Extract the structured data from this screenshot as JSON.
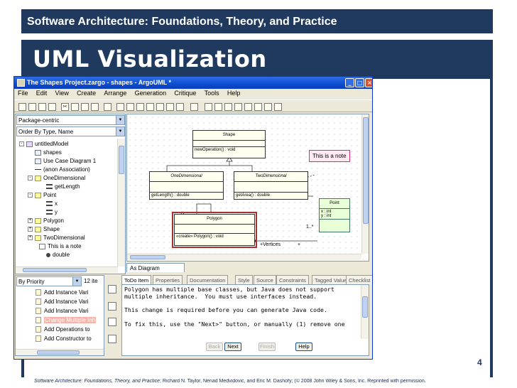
{
  "slide": {
    "header": "Software Architecture: Foundations, Theory, and Practice",
    "title": "UML Visualization",
    "page_number": "4",
    "footer_italic": "Software Architecture: Foundations, Theory, and Practice",
    "footer_rest": "; Richard N. Taylor, Nenad Medvidovic, and Eric M. Dashofy; (© 2008 John Wiley & Sons, Inc. Reprinted with permission."
  },
  "window": {
    "title": "The Shapes Project.zargo - shapes - ArgoUML *",
    "menu": [
      "File",
      "Edit",
      "View",
      "Create",
      "Arrange",
      "Generation",
      "Critique",
      "Tools",
      "Help"
    ]
  },
  "explorer": {
    "perspective": "Package-centric",
    "order": "Order By Type, Name",
    "tree": [
      {
        "label": "untitledModel",
        "icon": "model",
        "expander": "-"
      },
      {
        "label": "shapes",
        "icon": "diagram"
      },
      {
        "label": "Use Case Diagram 1",
        "icon": "diagram"
      },
      {
        "label": "(anon Association)",
        "icon": "line"
      },
      {
        "label": "OneDimensional",
        "icon": "cls",
        "expander": "-"
      },
      {
        "label": "getLength",
        "icon": "attr"
      },
      {
        "label": "Point",
        "icon": "cls",
        "expander": "-"
      },
      {
        "label": "x",
        "icon": "attr"
      },
      {
        "label": "y",
        "icon": "attr"
      },
      {
        "label": "Polygon",
        "icon": "cls",
        "expander": "+"
      },
      {
        "label": "Shape",
        "icon": "cls",
        "expander": "+"
      },
      {
        "label": "TwoDimensional",
        "icon": "cls",
        "expander": "+"
      },
      {
        "label": "This is a note",
        "icon": "note"
      },
      {
        "label": "double",
        "icon": "op"
      }
    ]
  },
  "diagram": {
    "tab": "As Diagram",
    "shape": {
      "name": "Shape",
      "op": "newOperation() : void"
    },
    "one_dim": {
      "name": "OneDimensional",
      "op": "getLength() : double"
    },
    "two_dim": {
      "name": "TwoDimensional",
      "op": "getArea() : double"
    },
    "polygon": {
      "name": "Polygon",
      "op": "«create» Polygon() : void"
    },
    "point": {
      "name": "Point",
      "attr_x": "x : int",
      "attr_y": "y : int"
    },
    "note": "This is a note",
    "multiplicity": "1..*",
    "role": "+Vertices",
    "role_end": "+"
  },
  "todo": {
    "grouping": "By Priority",
    "count": "12 ite",
    "items": [
      "Add Instance Vari",
      "Add Instance Vari",
      "Add Instance Vari",
      "Change Multiple Inh",
      "Add Operations to",
      "Add Constructor to"
    ],
    "selected_index": 3
  },
  "details": {
    "tabs": [
      "ToDo Item",
      "Properties",
      "Documentation",
      "Style",
      "Source",
      "Constraints",
      "Tagged Values",
      "Checklist"
    ],
    "active_tab": "ToDo Item",
    "text": "Polygon has multiple base classes, but Java does not support\nmultiple inheritance.  You must use interfaces instead.\n\nThis change is required before you can generate Java code.\n\nTo fix this, use the \"Next>\" button, or manually (1) remove one",
    "buttons": [
      "Back",
      "Next",
      "Finish",
      "Help"
    ]
  }
}
